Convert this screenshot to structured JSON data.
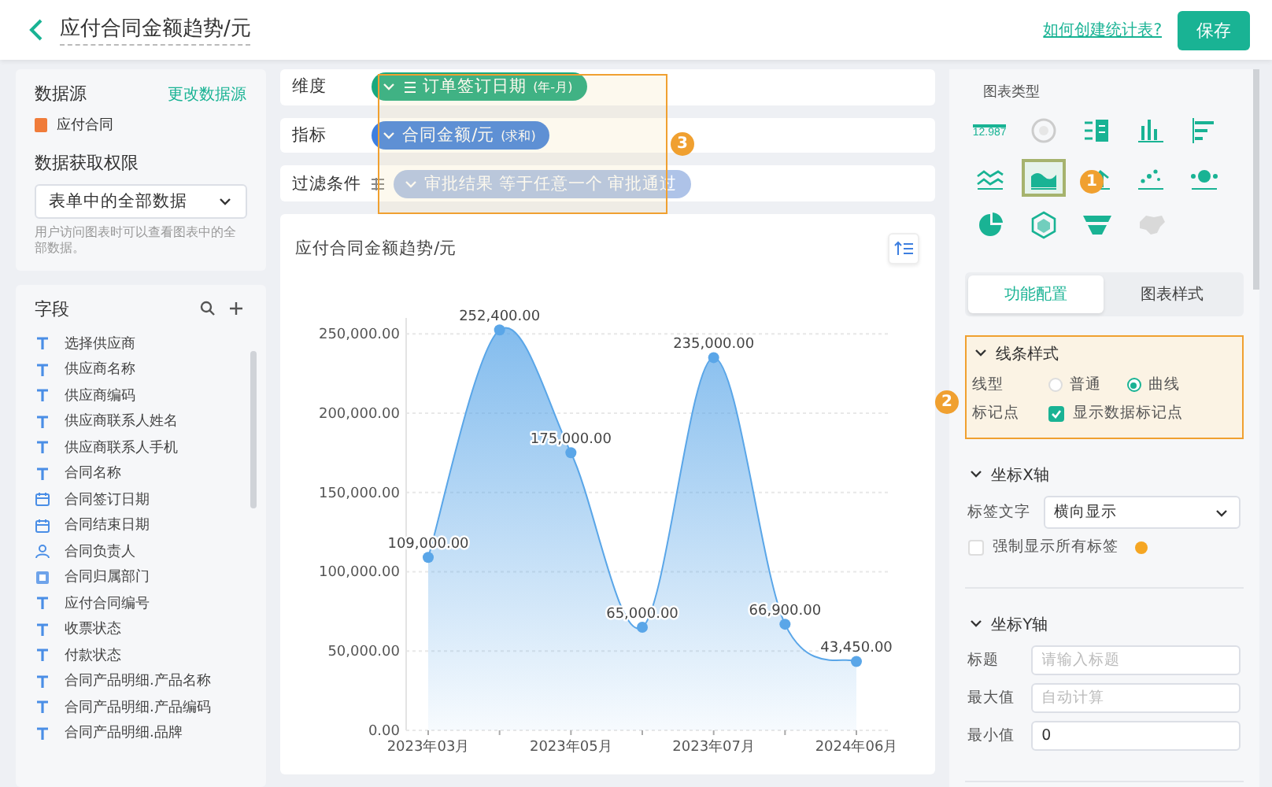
{
  "header": {
    "title": "应付合同金额趋势/元",
    "help_link": "如何创建统计表?",
    "save_button": "保存"
  },
  "data_source": {
    "label": "数据源",
    "change_link": "更改数据源",
    "source_name": "应付合同",
    "permission_label": "数据获取权限",
    "permission_value": "表单中的全部数据",
    "permission_hint": "用户访问图表时可以查看图表中的全部数据。"
  },
  "fields": {
    "title": "字段",
    "items": [
      {
        "kind": "text",
        "label": "选择供应商"
      },
      {
        "kind": "text",
        "label": "供应商名称"
      },
      {
        "kind": "text",
        "label": "供应商编码"
      },
      {
        "kind": "text",
        "label": "供应商联系人姓名"
      },
      {
        "kind": "text",
        "label": "供应商联系人手机"
      },
      {
        "kind": "text",
        "label": "合同名称"
      },
      {
        "kind": "date",
        "label": "合同签订日期"
      },
      {
        "kind": "date",
        "label": "合同结束日期"
      },
      {
        "kind": "person",
        "label": "合同负责人"
      },
      {
        "kind": "department",
        "label": "合同归属部门"
      },
      {
        "kind": "text",
        "label": "应付合同编号"
      },
      {
        "kind": "text",
        "label": "收票状态"
      },
      {
        "kind": "text",
        "label": "付款状态"
      },
      {
        "kind": "text",
        "label": "合同产品明细.产品名称"
      },
      {
        "kind": "text",
        "label": "合同产品明细.产品编码"
      },
      {
        "kind": "text",
        "label": "合同产品明细.品牌"
      }
    ]
  },
  "config_rows": [
    {
      "kind": "dimension",
      "label": "维度",
      "pill": {
        "label": "订单签订日期",
        "suffix": "(年-月)"
      }
    },
    {
      "kind": "measure",
      "label": "指标",
      "pill": {
        "label": "合同金额/元",
        "suffix": "(求和)"
      }
    },
    {
      "kind": "filter",
      "label": "过滤条件",
      "pill": {
        "label": "审批结果 等于任意一个 审批通过"
      }
    }
  ],
  "chart": {
    "title": "应付合同金额趋势/元",
    "chart_data": {
      "type": "area",
      "categories": [
        "2023年03月",
        null,
        "2023年05月",
        null,
        "2023年07月",
        null,
        "2024年06月"
      ],
      "grid": true,
      "ylim": [
        0,
        260000
      ],
      "yticks": [
        {
          "value": 0,
          "label": "0.00"
        },
        {
          "value": 50000,
          "label": "50,000.00"
        },
        {
          "value": 100000,
          "label": "100,000.00"
        },
        {
          "value": 150000,
          "label": "150,000.00"
        },
        {
          "value": 200000,
          "label": "200,000.00"
        },
        {
          "value": 250000,
          "label": "250,000.00"
        }
      ],
      "series": [
        {
          "color": "#5aa6e8",
          "values": [
            109000,
            252400,
            175000,
            65000,
            235000,
            66900,
            43450
          ]
        }
      ],
      "value_labels": [
        "109,000.00",
        "252,400.00",
        "175,000.00",
        "65,000.00",
        "235,000.00",
        "66,900.00",
        "43,450.00"
      ]
    }
  },
  "chart_types": {
    "title": "图表类型",
    "items": [
      {
        "kind": "number",
        "label": "12.987",
        "selected": false
      },
      {
        "kind": "gauge",
        "selected": false
      },
      {
        "kind": "table",
        "selected": false
      },
      {
        "kind": "column",
        "selected": false
      },
      {
        "kind": "bar",
        "selected": false
      },
      {
        "kind": "line",
        "selected": false
      },
      {
        "kind": "area",
        "selected": true
      },
      {
        "kind": "combo",
        "selected": false
      },
      {
        "kind": "scatter",
        "selected": false
      },
      {
        "kind": "bubble",
        "selected": false
      },
      {
        "kind": "pie",
        "selected": false
      },
      {
        "kind": "radar",
        "selected": false
      },
      {
        "kind": "funnel",
        "selected": false
      },
      {
        "kind": "map",
        "selected": false
      }
    ]
  },
  "config_tabs": [
    {
      "label": "功能配置",
      "selected": true
    },
    {
      "label": "图表样式",
      "selected": false
    }
  ],
  "line_style": {
    "title": "线条样式",
    "expanded": true,
    "highlighted": true,
    "line_type_label": "线型",
    "line_types": [
      {
        "label": "普通",
        "selected": false
      },
      {
        "label": "曲线",
        "selected": true
      }
    ],
    "marker_label": "标记点",
    "marker_option": {
      "label": "显示数据标记点",
      "checked": true
    }
  },
  "x_axis": {
    "title": "坐标X轴",
    "expanded": true,
    "label_text_label": "标签文字",
    "label_text_value": "横向显示",
    "force_all": {
      "label": "强制显示所有标签",
      "checked": false
    }
  },
  "y_axis": {
    "title": "坐标Y轴",
    "expanded": true,
    "fields": [
      {
        "label": "标题",
        "placeholder": "请输入标题"
      },
      {
        "label": "最大值",
        "placeholder": "自动计算"
      },
      {
        "label": "最小值",
        "value": "0"
      }
    ]
  },
  "callouts": [
    {
      "number": "1"
    },
    {
      "number": "2"
    },
    {
      "number": "3"
    }
  ]
}
